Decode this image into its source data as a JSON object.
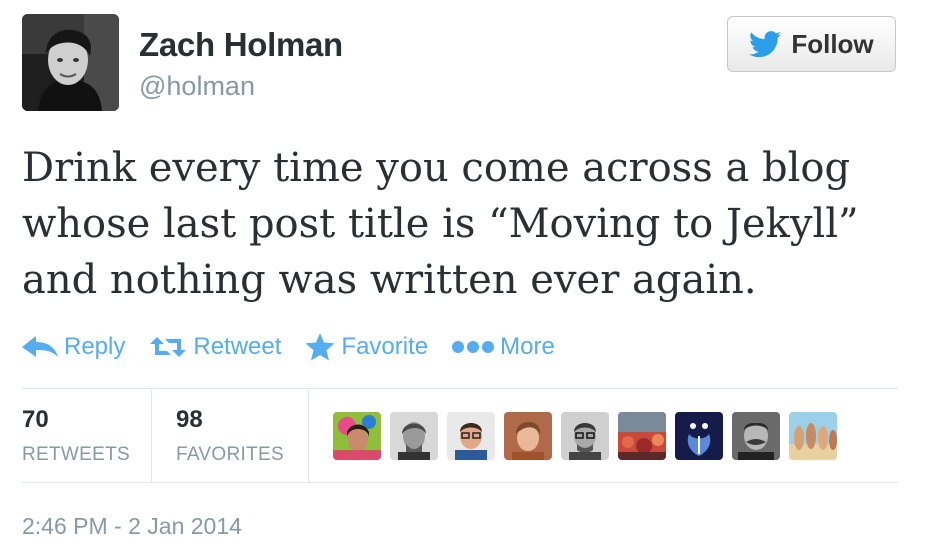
{
  "user": {
    "name": "Zach Holman",
    "handle": "@holman"
  },
  "follow_button": {
    "label": "Follow"
  },
  "tweet": {
    "lines": [
      "Drink every time you come across a blog",
      "whose last post title is “Moving to Jekyll”",
      "and nothing was written ever again."
    ]
  },
  "actions": [
    {
      "label": "Reply",
      "icon": "reply-icon"
    },
    {
      "label": "Retweet",
      "icon": "retweet-icon"
    },
    {
      "label": "Favorite",
      "icon": "star-icon"
    },
    {
      "label": "More",
      "icon": "more-dots-icon"
    }
  ],
  "stats": {
    "retweets": {
      "count": "70",
      "label": "RETWEETS"
    },
    "favorites": {
      "count": "98",
      "label": "FAVORITES"
    }
  },
  "favoriters_count_shown": 9,
  "timestamp": "2:46 PM - 2 Jan 2014",
  "colors": {
    "action_blue": "#55acee",
    "twitter_bird": "#2b9de9",
    "muted_text": "#8899a6",
    "primary_text": "#292f33",
    "divider": "#e1e8ed"
  }
}
